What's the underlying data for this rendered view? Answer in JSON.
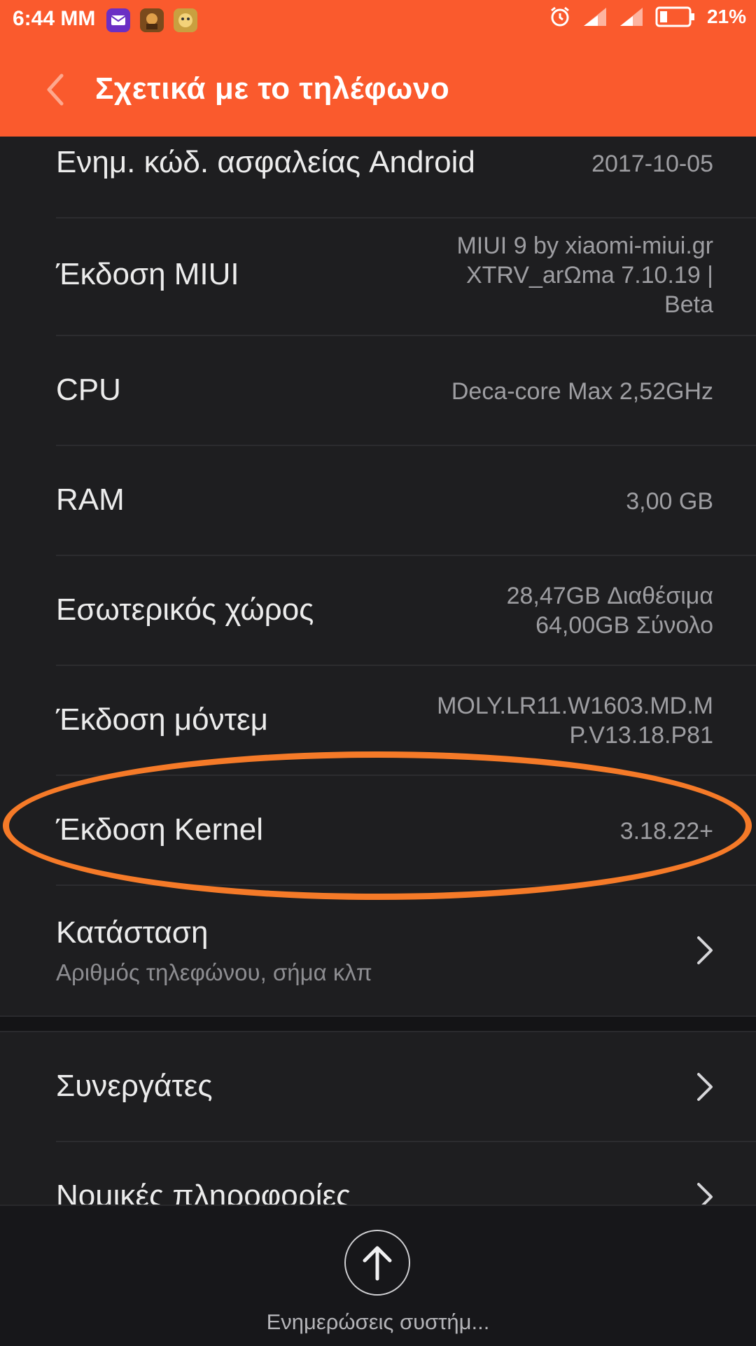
{
  "status_bar": {
    "time": "6:44 MM",
    "battery": "21%",
    "icons": [
      "mail-app-icon",
      "game-app-icon",
      "clash-app-icon",
      "alarm-icon",
      "signal-icon",
      "signal-icon-2",
      "battery-icon"
    ]
  },
  "header": {
    "title": "Σχετικά με το τηλέφωνο",
    "accent_color": "#fa5a2d"
  },
  "rows": [
    {
      "label": "Ενημ. κώδ. ασφαλείας Android",
      "value_lines": [
        "2017-10-05"
      ]
    },
    {
      "label": "Έκδοση MIUI",
      "value_lines": [
        "MIUI 9 by xiaomi-miui.gr",
        "XTRV_arΩma  7.10.19 |",
        "Beta"
      ]
    },
    {
      "label": "CPU",
      "value_lines": [
        "Deca-core Max 2,52GHz"
      ]
    },
    {
      "label": "RAM",
      "value_lines": [
        "3,00 GB"
      ]
    },
    {
      "label": "Εσωτερικός χώρος",
      "value_lines": [
        "28,47GB Διαθέσιμα",
        "64,00GB Σύνολο"
      ]
    },
    {
      "label": "Έκδοση μόντεμ",
      "value_lines": [
        "MOLY.LR11.W1603.MD.M",
        "P.V13.18.P81"
      ]
    },
    {
      "label": "Έκδοση Kernel",
      "value_lines": [
        "3.18.22+"
      ]
    }
  ],
  "status_row": {
    "label": "Κατάσταση",
    "sublabel": "Αριθμός τηλεφώνου, σήμα κλπ"
  },
  "partners_row": {
    "label": "Συνεργάτες"
  },
  "legal_row": {
    "label": "Νομικές πληροφορίες"
  },
  "bottom": {
    "update_label": "Ενημερώσεις συστήμ..."
  },
  "highlight_color": "#f57a28"
}
